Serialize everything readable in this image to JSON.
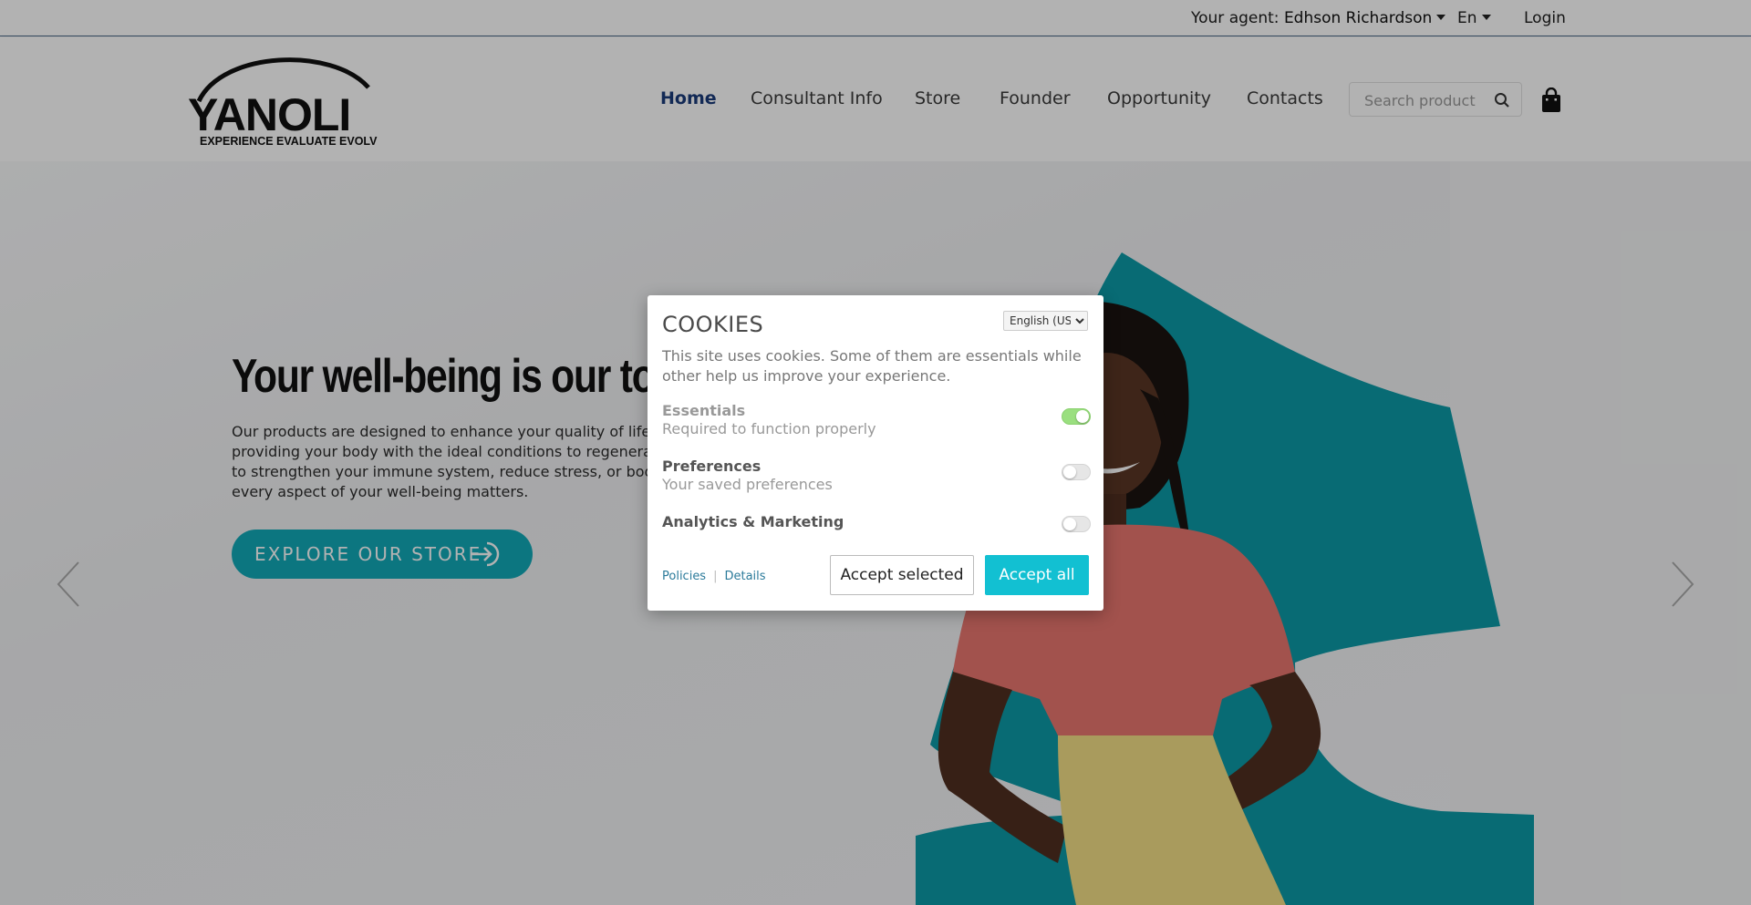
{
  "topbar": {
    "agent_label": "Your agent:",
    "agent_name": "Edhson Richardson",
    "language": "En",
    "login": "Login"
  },
  "header": {
    "logo_text": "YANOLI",
    "logo_tagline": "EXPERIENCE EVALUATE EVOLVE",
    "nav": [
      "Home",
      "Consultant Info",
      "Store",
      "Founder",
      "Opportunity",
      "Contacts"
    ],
    "active_nav": "Home",
    "search_placeholder": "Search product"
  },
  "hero": {
    "headline": "Your well-being is our top",
    "paragraph_lines": [
      "Our products are designed to enhance your quality of life ove",
      "providing your body with the ideal conditions to regenerate. W",
      "to strengthen your immune system, reduce stress, or boost y",
      "every aspect of your well-being matters."
    ],
    "cta": "EXPLORE OUR STORE"
  },
  "cookies": {
    "title": "COOKIES",
    "language_option": "English (US)",
    "description": "This site uses cookies. Some of them are essentials while other help us improve your experience.",
    "options": [
      {
        "name": "Essentials",
        "sub": "Required to function properly",
        "enabled": true
      },
      {
        "name": "Preferences",
        "sub": "Your saved preferences",
        "enabled": false
      },
      {
        "name": "Analytics & Marketing",
        "sub": "",
        "enabled": false
      }
    ],
    "policies_link": "Policies",
    "details_link": "Details",
    "accept_selected": "Accept selected",
    "accept_all": "Accept all"
  },
  "colors": {
    "brand_teal": "#12a9b8",
    "accept_all": "#12c0d2",
    "toggle_on": "#9adf7f",
    "active_nav": "#1a3b7a"
  }
}
